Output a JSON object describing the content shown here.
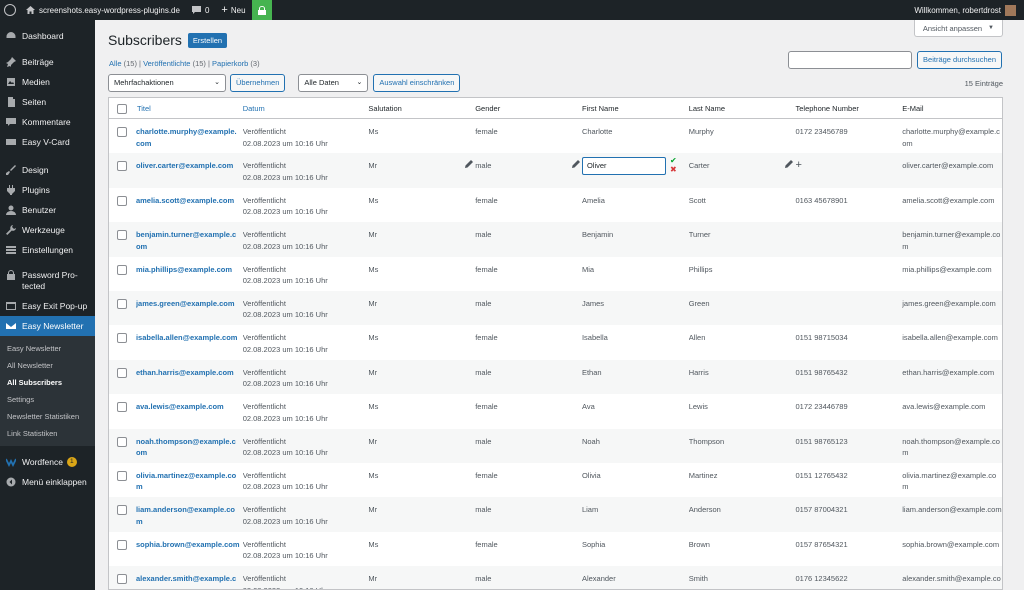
{
  "adminbar": {
    "site": "screenshots.easy-wordpress-plugins.de",
    "comments": "0",
    "new_label": "Neu",
    "greeting": "Willkommen, robertdrost"
  },
  "sidebar": {
    "items": [
      {
        "label": "Dashboard",
        "icon": "dashboard-icon"
      },
      {
        "label": "Beiträge",
        "icon": "pin-icon"
      },
      {
        "label": "Medien",
        "icon": "media-icon"
      },
      {
        "label": "Seiten",
        "icon": "pages-icon"
      },
      {
        "label": "Kommentare",
        "icon": "comments-icon"
      },
      {
        "label": "Easy V-Card",
        "icon": "vcard-icon"
      },
      {
        "label": "Design",
        "icon": "brush-icon"
      },
      {
        "label": "Plugins",
        "icon": "plugin-icon"
      },
      {
        "label": "Benutzer",
        "icon": "user-icon"
      },
      {
        "label": "Werkzeuge",
        "icon": "wrench-icon"
      },
      {
        "label": "Einstellungen",
        "icon": "settings-icon"
      },
      {
        "label": "Password Pro- tected",
        "icon": "lock-icon"
      },
      {
        "label": "Easy Exit Pop-up",
        "icon": "popup-icon"
      },
      {
        "label": "Easy Newsletter",
        "icon": "mail-icon"
      }
    ],
    "submenu": [
      "Easy Newsletter",
      "All Newsletter",
      "All Subscribers",
      "Settings",
      "Newsletter Statistiken",
      "Link Statistiken"
    ],
    "wordfence": {
      "label": "Wordfence",
      "badge": "1"
    },
    "collapse": "Menü einklappen"
  },
  "header": {
    "screen_options": "Ansicht anpassen",
    "title": "Subscribers",
    "create_button": "Erstellen"
  },
  "views": {
    "all": "Alle",
    "all_count": "(15)",
    "published": "Veröffentlichte",
    "published_count": "(15)",
    "trash": "Papierkorb",
    "trash_count": "(3)"
  },
  "search": {
    "button": "Beiträge durchsuchen"
  },
  "tablenav": {
    "bulk_actions": "Mehrfachaktionen",
    "apply": "Übernehmen",
    "dates": "Alle Daten",
    "filter": "Auswahl einschränken",
    "count": "15 Einträge"
  },
  "table": {
    "columns": [
      "Titel",
      "Datum",
      "Salutation",
      "Gender",
      "First Name",
      "Last Name",
      "Telephone Number",
      "E-Mail"
    ],
    "status": "Veröffentlicht",
    "edit_value": "Oliver",
    "rows": [
      {
        "title": "charlotte.murphy@example.com",
        "date": "02.08.2023 um 10:16 Uhr",
        "salutation": "Ms",
        "gender": "female",
        "first": "Charlotte",
        "last": "Murphy",
        "tel": "0172 23456789",
        "email": "charlotte.murphy@example.com"
      },
      {
        "title": "oliver.carter@example.com",
        "date": "02.08.2023 um 10:16 Uhr",
        "salutation": "Mr",
        "gender": "male",
        "first": "Oliver",
        "last": "Carter",
        "tel": "",
        "email": "oliver.carter@example.com"
      },
      {
        "title": "amelia.scott@example.com",
        "date": "02.08.2023 um 10:16 Uhr",
        "salutation": "Ms",
        "gender": "female",
        "first": "Amelia",
        "last": "Scott",
        "tel": "0163 45678901",
        "email": "amelia.scott@example.com"
      },
      {
        "title": "benjamin.turner@example.com",
        "date": "02.08.2023 um 10:16 Uhr",
        "salutation": "Mr",
        "gender": "male",
        "first": "Benjamin",
        "last": "Turner",
        "tel": "",
        "email": "benjamin.turner@example.com"
      },
      {
        "title": "mia.phillips@example.com",
        "date": "02.08.2023 um 10:16 Uhr",
        "salutation": "Ms",
        "gender": "female",
        "first": "Mia",
        "last": "Phillips",
        "tel": "",
        "email": "mia.phillips@example.com"
      },
      {
        "title": "james.green@example.com",
        "date": "02.08.2023 um 10:16 Uhr",
        "salutation": "Mr",
        "gender": "male",
        "first": "James",
        "last": "Green",
        "tel": "",
        "email": "james.green@example.com"
      },
      {
        "title": "isabella.allen@example.com",
        "date": "02.08.2023 um 10:16 Uhr",
        "salutation": "Ms",
        "gender": "female",
        "first": "Isabella",
        "last": "Allen",
        "tel": "0151 98715034",
        "email": "isabella.allen@example.com"
      },
      {
        "title": "ethan.harris@example.com",
        "date": "02.08.2023 um 10:16 Uhr",
        "salutation": "Mr",
        "gender": "male",
        "first": "Ethan",
        "last": "Harris",
        "tel": "0151 98765432",
        "email": "ethan.harris@example.com"
      },
      {
        "title": "ava.lewis@example.com",
        "date": "02.08.2023 um 10:16 Uhr",
        "salutation": "Ms",
        "gender": "female",
        "first": "Ava",
        "last": "Lewis",
        "tel": "0172 23446789",
        "email": "ava.lewis@example.com"
      },
      {
        "title": "noah.thompson@example.com",
        "date": "02.08.2023 um 10:16 Uhr",
        "salutation": "Mr",
        "gender": "male",
        "first": "Noah",
        "last": "Thompson",
        "tel": "0151 98765123",
        "email": "noah.thompson@example.com"
      },
      {
        "title": "olivia.martinez@example.com",
        "date": "02.08.2023 um 10:16 Uhr",
        "salutation": "Ms",
        "gender": "female",
        "first": "Olivia",
        "last": "Martinez",
        "tel": "0151 12765432",
        "email": "olivia.martinez@example.com"
      },
      {
        "title": "liam.anderson@example.com",
        "date": "02.08.2023 um 10:16 Uhr",
        "salutation": "Mr",
        "gender": "male",
        "first": "Liam",
        "last": "Anderson",
        "tel": "0157 87004321",
        "email": "liam.anderson@example.com"
      },
      {
        "title": "sophia.brown@example.com",
        "date": "02.08.2023 um 10:16 Uhr",
        "salutation": "Ms",
        "gender": "female",
        "first": "Sophia",
        "last": "Brown",
        "tel": "0157 87654321",
        "email": "sophia.brown@example.com"
      },
      {
        "title": "alexander.smith@example.com",
        "date": "02.08.2023 um 10:16 Uhr",
        "salutation": "Mr",
        "gender": "male",
        "first": "Alexander",
        "last": "Smith",
        "tel": "0176 12345622",
        "email": "alexander.smith@example.com"
      }
    ]
  },
  "colors": {
    "accent": "#2271b1",
    "adminbar": "#1d2327",
    "lock": "#46b450"
  }
}
